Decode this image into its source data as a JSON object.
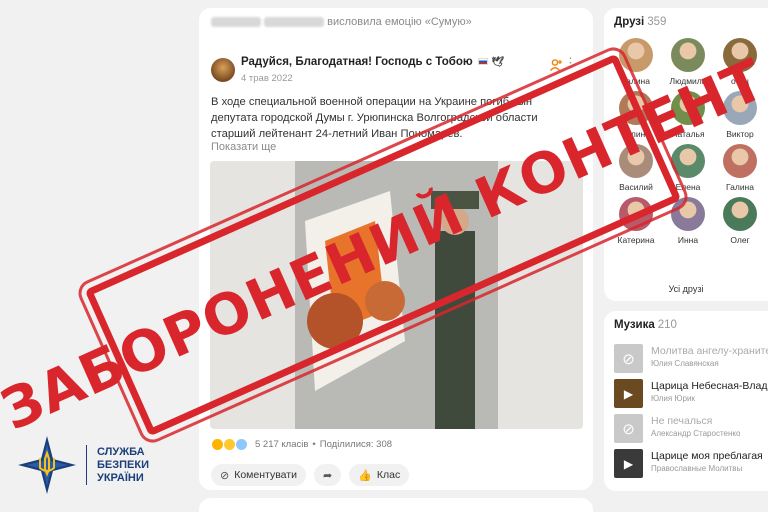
{
  "post": {
    "activity": "висловила емоцію «Сумую»",
    "author": "Радуйся, Благодатная! Господь с Тобою",
    "date": "4 трав 2022",
    "text": "В ходе специальной военной операции на Украине погиб сын депутата городской Думы г. Урюпинска Волгоградской области старший лейтенант 24-летний Иван Пономарев.",
    "show_more": "Показати ще",
    "reactions_count": "5 217 класів",
    "shares": "Поділилися: 308",
    "comment_label": "Коментувати",
    "like_label": "Клас"
  },
  "friends": {
    "title": "Друзі",
    "count": "359",
    "items": [
      {
        "name": "Галина",
        "color": "#c89a6a"
      },
      {
        "name": "Людмила",
        "color": "#7b8a5c"
      },
      {
        "name": "отец",
        "color": "#8a6a3a"
      },
      {
        "name": "Галина",
        "color": "#b07a58"
      },
      {
        "name": "Наталья",
        "color": "#6f8f4a"
      },
      {
        "name": "Виктор",
        "color": "#9aa7b8"
      },
      {
        "name": "Василий",
        "color": "#a98d7a"
      },
      {
        "name": "Елена",
        "color": "#5a8a6a"
      },
      {
        "name": "Галина",
        "color": "#c07060"
      },
      {
        "name": "Катерина",
        "color": "#b85a6a"
      },
      {
        "name": "Инна",
        "color": "#8a7a9a"
      },
      {
        "name": "Олег",
        "color": "#4a7a5a"
      }
    ],
    "all_label": "Усі друзі"
  },
  "music": {
    "title": "Музика",
    "count": "210",
    "tracks": [
      {
        "title": "Молитва ангелу-хранителю",
        "artist": "Юлия Славянская",
        "available": false
      },
      {
        "title": "Царица Небесная-Владычица",
        "artist": "Юлия Юрик",
        "available": true
      },
      {
        "title": "Не печалься",
        "artist": "Александр Старостенко",
        "available": false
      },
      {
        "title": "Царице моя преблагая",
        "artist": "Православные Молитвы",
        "available": true
      }
    ]
  },
  "sbu": {
    "line1": "СЛУЖБА",
    "line2": "БЕЗПЕКИ",
    "line3": "УКРАЇНИ"
  },
  "stamp": {
    "text": "ЗАБОРОНЕНИЙ КОНТЕНТ"
  }
}
